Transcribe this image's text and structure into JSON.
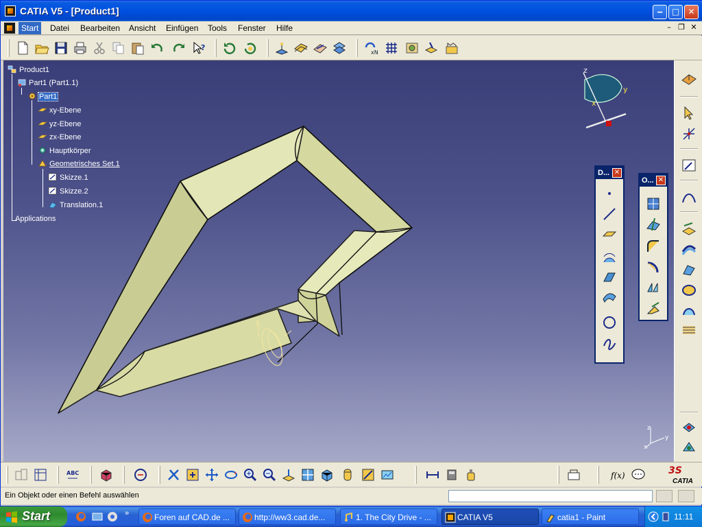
{
  "window": {
    "title": "CATIA V5 - [Product1]"
  },
  "menu": {
    "items": [
      "Start",
      "Datei",
      "Bearbeiten",
      "Ansicht",
      "Einfügen",
      "Tools",
      "Fenster",
      "Hilfe"
    ],
    "active": "Start"
  },
  "tree": {
    "root": "Product1",
    "part_instance": "Part1 (Part1.1)",
    "part": "Part1",
    "plane_xy": "xy-Ebene",
    "plane_yz": "yz-Ebene",
    "plane_zx": "zx-Ebene",
    "body": "Hauptkörper",
    "geoset": "Geometrisches Set.1",
    "sketch1": "Skizze.1",
    "sketch2": "Skizze.2",
    "translation": "Translation.1",
    "applications": "Applications"
  },
  "compass": {
    "z": "z",
    "y": "y",
    "x": "x"
  },
  "axis_triad": {
    "z": "z",
    "y": "y",
    "x": "x"
  },
  "palettes": {
    "points": {
      "title": "D..."
    },
    "operations": {
      "title": "O..."
    }
  },
  "status": {
    "message": "Ein Objekt oder einen Befehl auswählen",
    "command_value": ""
  },
  "logo": "CATIA",
  "taskbar": {
    "start_label": "Start",
    "tasks": [
      "Foren auf CAD.de ...",
      "http://ww3.cad.de...",
      "1. The City Drive - ...",
      "CATIA V5",
      "catia1 - Paint"
    ],
    "active_task": "CATIA V5",
    "clock": "11:11"
  },
  "colors": {
    "selection": "#316ac5",
    "titlebar": "#0050e0",
    "surface": "#e2e6b6",
    "taskbar": "#245edb",
    "start": "#3c9a3c"
  },
  "toolbar_top_icons": [
    "new-icon",
    "open-icon",
    "save-icon",
    "print-icon",
    "cut-icon",
    "copy-icon",
    "paste-icon",
    "undo-icon",
    "redo-icon",
    "whats-this-icon",
    "update-icon",
    "update-all-icon",
    "snap-icon",
    "plane-icon",
    "sketch-plane-icon",
    "measure-icon",
    "axis-icon",
    "grid-icon",
    "analysis-icon",
    "layer-icon",
    "catalog-icon"
  ],
  "toolbar_bottom_icons": [
    "properties-icon",
    "sketch-icon",
    "text-icon",
    "part-design-icon",
    "swap-icon",
    "pan-icon",
    "fit-all-icon",
    "move-icon",
    "rotate-icon",
    "zoom-in-icon",
    "zoom-out-icon",
    "normal-view-icon",
    "multi-view-icon",
    "iso-view-icon",
    "shading-icon",
    "hide-show-icon",
    "swap-visible-icon",
    "measure-between-icon",
    "measure-item-icon",
    "measure-inertia-icon",
    "render-icon",
    "formula-icon",
    "knowledge-icon"
  ]
}
